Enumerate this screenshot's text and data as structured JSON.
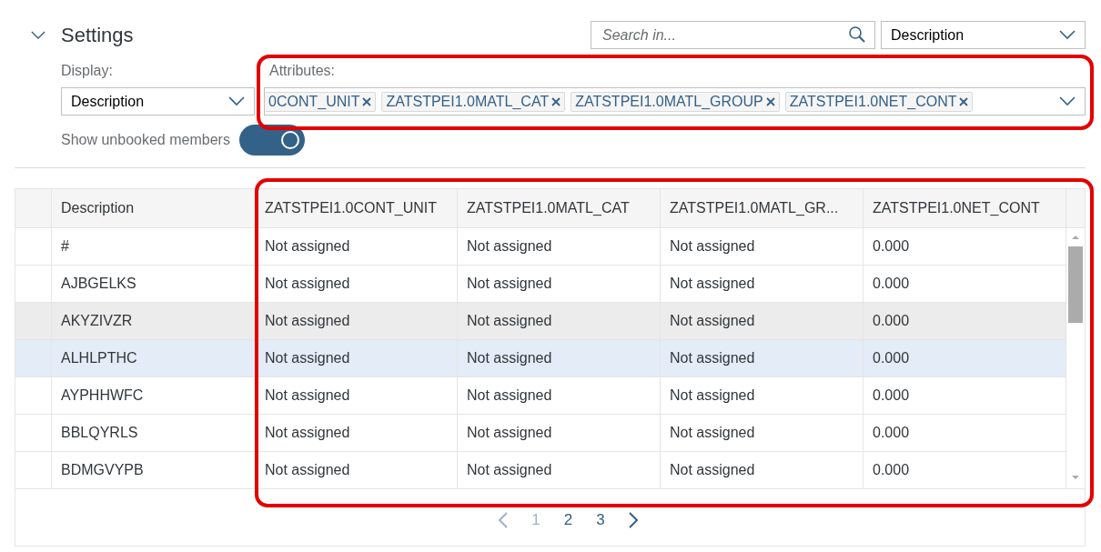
{
  "settings": {
    "title": "Settings",
    "expanded": true,
    "search": {
      "placeholder": "Search in..."
    },
    "search_scope": {
      "value": "Description"
    },
    "display": {
      "label": "Display:",
      "value": "Description"
    },
    "attributes": {
      "label": "Attributes:",
      "tokens": [
        "0CONT_UNIT",
        "ZATSTPEI1.0MATL_CAT",
        "ZATSTPEI1.0MATL_GROUP",
        "ZATSTPEI1.0NET_CONT"
      ]
    },
    "show_unbooked": {
      "label": "Show unbooked members",
      "on": true
    }
  },
  "table": {
    "columns": [
      "Description",
      "ZATSTPEI1.0CONT_UNIT",
      "ZATSTPEI1.0MATL_CAT",
      "ZATSTPEI1.0MATL_GR...",
      "ZATSTPEI1.0NET_CONT"
    ],
    "rows": [
      {
        "cells": [
          "#",
          "Not assigned",
          "Not assigned",
          "Not assigned",
          "0.000"
        ],
        "selected": false,
        "hovered": false
      },
      {
        "cells": [
          "AJBGELKS",
          "Not assigned",
          "Not assigned",
          "Not assigned",
          "0.000"
        ],
        "selected": false,
        "hovered": false
      },
      {
        "cells": [
          "AKYZIVZR",
          "Not assigned",
          "Not assigned",
          "Not assigned",
          "0.000"
        ],
        "selected": false,
        "hovered": true
      },
      {
        "cells": [
          "ALHLPTHC",
          "Not assigned",
          "Not assigned",
          "Not assigned",
          "0.000"
        ],
        "selected": true,
        "hovered": false
      },
      {
        "cells": [
          "AYPHHWFC",
          "Not assigned",
          "Not assigned",
          "Not assigned",
          "0.000"
        ],
        "selected": false,
        "hovered": false
      },
      {
        "cells": [
          "BBLQYRLS",
          "Not assigned",
          "Not assigned",
          "Not assigned",
          "0.000"
        ],
        "selected": false,
        "hovered": false
      },
      {
        "cells": [
          "BDMGVYPB",
          "Not assigned",
          "Not assigned",
          "Not assigned",
          "0.000"
        ],
        "selected": false,
        "hovered": false
      }
    ]
  },
  "pagination": {
    "pages": [
      {
        "label": "1",
        "selected": true
      },
      {
        "label": "2",
        "selected": false
      },
      {
        "label": "3",
        "selected": false
      }
    ],
    "prev_disabled": true,
    "next_disabled": false
  }
}
